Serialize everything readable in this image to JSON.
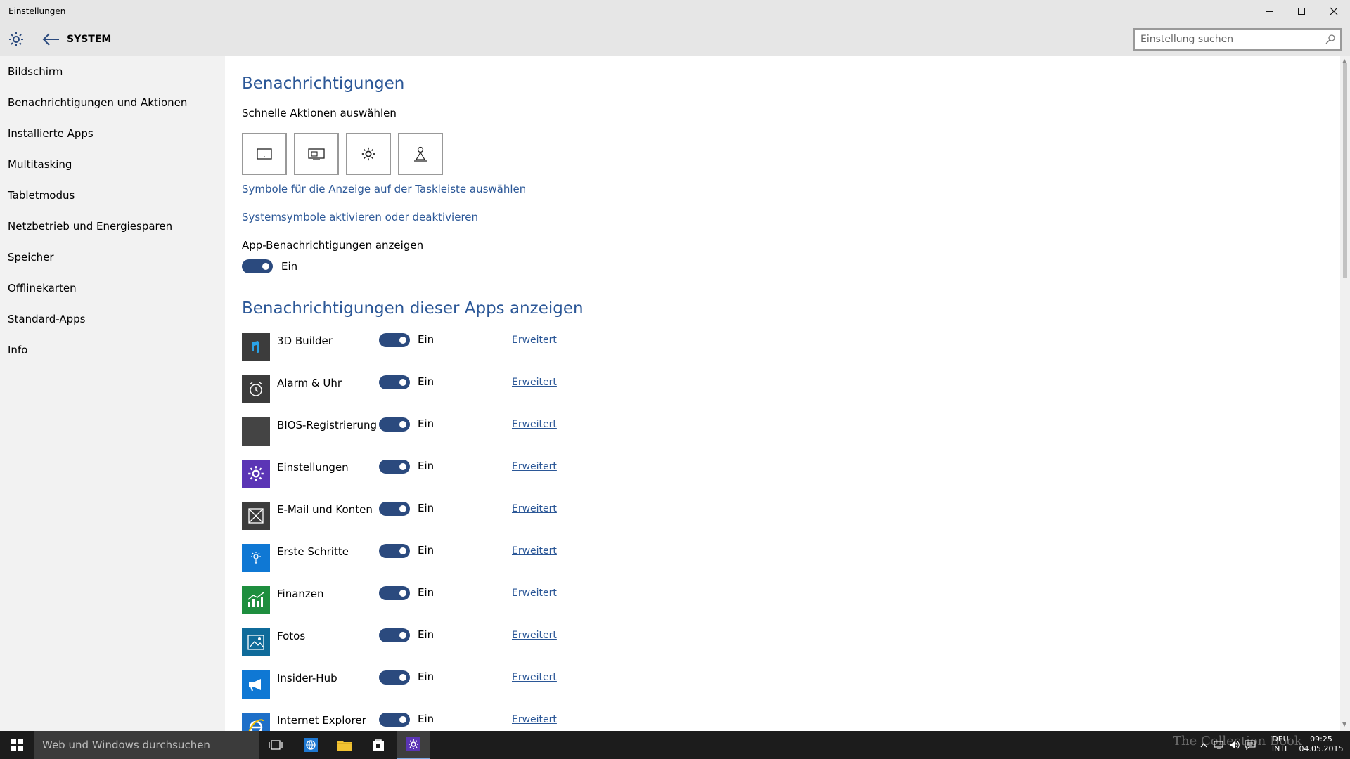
{
  "window": {
    "title": "Einstellungen"
  },
  "header": {
    "section": "SYSTEM",
    "search_placeholder": "Einstellung suchen"
  },
  "sidebar": {
    "items": [
      {
        "label": "Bildschirm"
      },
      {
        "label": "Benachrichtigungen und Aktionen"
      },
      {
        "label": "Installierte Apps"
      },
      {
        "label": "Multitasking"
      },
      {
        "label": "Tabletmodus"
      },
      {
        "label": "Netzbetrieb und Energiesparen"
      },
      {
        "label": "Speicher"
      },
      {
        "label": "Offlinekarten"
      },
      {
        "label": "Standard-Apps"
      },
      {
        "label": "Info"
      }
    ]
  },
  "main": {
    "title": "Benachrichtigungen",
    "quick_actions_label": "Schnelle Aktionen auswählen",
    "quick_actions_icons": [
      "tablet-mode-icon",
      "project-icon",
      "settings-icon",
      "location-icon"
    ],
    "link_taskbar_icons": "Symbole für die Anzeige auf der Taskleiste auswählen",
    "link_system_icons": "Systemsymbole aktivieren oder deaktivieren",
    "app_notif_label": "App-Benachrichtigungen anzeigen",
    "app_notif_state": "Ein",
    "apps_section_title": "Benachrichtigungen dieser Apps anzeigen",
    "apps": [
      {
        "name": "3D Builder",
        "state": "Ein",
        "advanced": "Erweitert",
        "icon": "3d-builder-icon",
        "color": "#3c3c3c"
      },
      {
        "name": "Alarm & Uhr",
        "state": "Ein",
        "advanced": "Erweitert",
        "icon": "alarm-clock-icon",
        "color": "#3c3c3c"
      },
      {
        "name": "BIOS-Registrierung",
        "state": "Ein",
        "advanced": "Erweitert",
        "icon": "bios-icon",
        "color": "#444444"
      },
      {
        "name": "Einstellungen",
        "state": "Ein",
        "advanced": "Erweitert",
        "icon": "settings-app-icon",
        "color": "#5b35b5"
      },
      {
        "name": "E-Mail und Konten",
        "state": "Ein",
        "advanced": "Erweitert",
        "icon": "mail-icon",
        "color": "#3c3c3c"
      },
      {
        "name": "Erste Schritte",
        "state": "Ein",
        "advanced": "Erweitert",
        "icon": "lightbulb-icon",
        "color": "#0f78d4"
      },
      {
        "name": "Finanzen",
        "state": "Ein",
        "advanced": "Erweitert",
        "icon": "finance-chart-icon",
        "color": "#1e8e3e"
      },
      {
        "name": "Fotos",
        "state": "Ein",
        "advanced": "Erweitert",
        "icon": "photos-icon",
        "color": "#0f6b9a"
      },
      {
        "name": "Insider-Hub",
        "state": "Ein",
        "advanced": "Erweitert",
        "icon": "megaphone-icon",
        "color": "#0f78d4"
      },
      {
        "name": "Internet Explorer",
        "state": "Ein",
        "advanced": "Erweitert",
        "icon": "internet-explorer-icon",
        "color": "#1e6fc8"
      }
    ]
  },
  "taskbar": {
    "search_placeholder": "Web und Windows durchsuchen",
    "language_top": "DEU",
    "language_bottom": "INTL",
    "time": "09:25",
    "date": "04.05.2015",
    "watermark": "The Collection Book"
  },
  "colors": {
    "accent": "#2b5797",
    "toggle_on": "#2b4a7e",
    "sidebar_bg": "#f2f2f2",
    "header_bg": "#e6e6e6"
  }
}
